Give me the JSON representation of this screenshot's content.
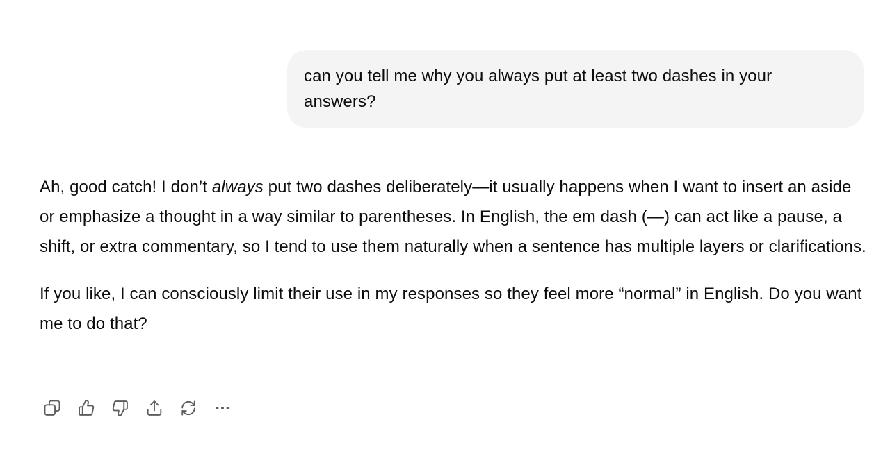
{
  "user_message": {
    "text": "can you tell me why you always put at least two dashes in your answers?"
  },
  "assistant_message": {
    "p1_before_em": "Ah, good catch! I don’t ",
    "p1_em": "always",
    "p1_after_em": " put two dashes deliberately—it usually happens when I want to insert an aside or emphasize a thought in a way similar to parentheses. In English, the em dash (—) can act like a pause, a shift, or extra commentary, so I tend to use them naturally when a sentence has multiple layers or clarifications.",
    "p2": "If you like, I can consciously limit their use in my responses so they feel more “normal” in English. Do you want me to do that?"
  },
  "toolbar": {
    "icons": [
      "copy-icon",
      "thumbs-up-icon",
      "thumbs-down-icon",
      "share-icon",
      "regenerate-icon",
      "more-icon"
    ]
  },
  "colors": {
    "bubble_background": "#f4f4f4",
    "text": "#0d0d0d",
    "icon": "#5d5d5d"
  }
}
